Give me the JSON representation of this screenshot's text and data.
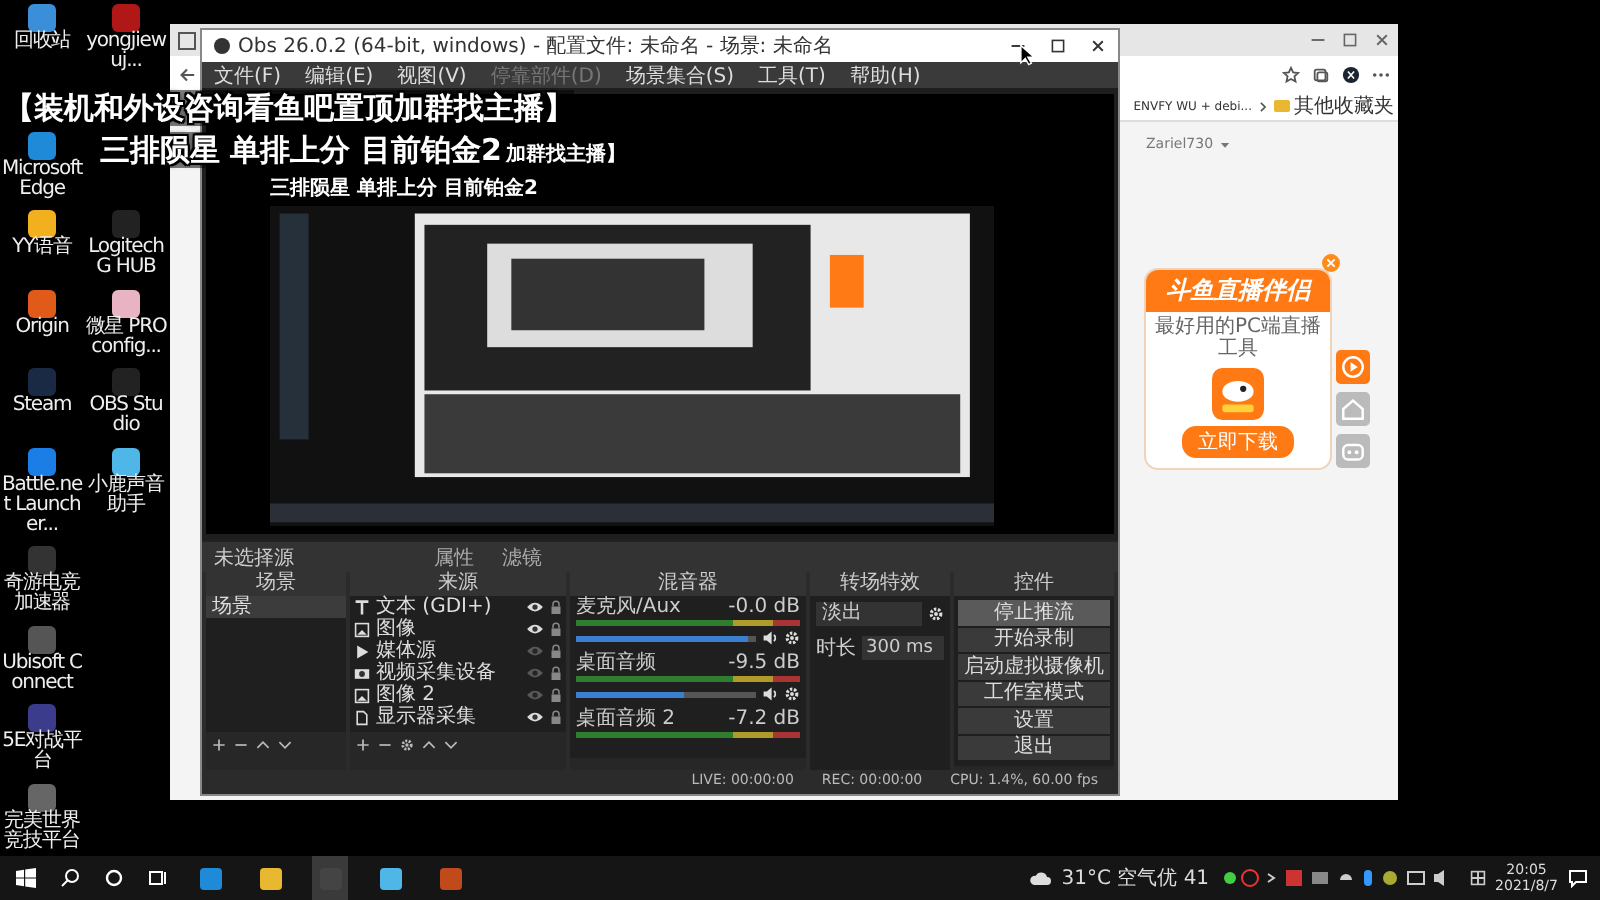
{
  "overlay": {
    "headline": "【装机和外设咨询看鱼吧置顶加群找主播】",
    "subline": "三排陨星 单排上分 目前铂金2",
    "subline_echo": "加群找主播】"
  },
  "desktop": {
    "icon_rows": [
      [
        {
          "label": "回收站"
        },
        {
          "label": "yongjiewuj..."
        }
      ],
      [
        {
          "label": "Microsoft Edge"
        }
      ],
      [
        {
          "label": "YY语音"
        },
        {
          "label": "Logitech G HUB"
        }
      ],
      [
        {
          "label": "Origin"
        },
        {
          "label": "微星 PROconfig..."
        }
      ],
      [
        {
          "label": "Steam"
        },
        {
          "label": "OBS Studio"
        }
      ],
      [
        {
          "label": "Battle.net Launcher..."
        },
        {
          "label": "小鹿声音助手"
        }
      ],
      [
        {
          "label": "奇游电竞加速器"
        }
      ],
      [
        {
          "label": "Ubisoft Connect"
        }
      ],
      [
        {
          "label": "5E对战平台"
        }
      ],
      [
        {
          "label": "完美世界竞技平台"
        }
      ]
    ]
  },
  "browser": {
    "bookmark": "ENVFY WU + debi...",
    "other_favorites": "其他收藏夹",
    "account": "Zariel730",
    "ad": {
      "title": "斗鱼直播伴侣",
      "tagline": "最好用的PC端直播工具",
      "download": "立即下载"
    }
  },
  "obs": {
    "title": "Obs 26.0.2 (64-bit, windows) - 配置文件: 未命名 - 场景: 未命名",
    "menu": [
      {
        "label": "文件(F)",
        "disabled": false
      },
      {
        "label": "编辑(E)",
        "disabled": false
      },
      {
        "label": "视图(V)",
        "disabled": false
      },
      {
        "label": "停靠部件(D)",
        "disabled": true
      },
      {
        "label": "场景集合(S)",
        "disabled": false
      },
      {
        "label": "工具(T)",
        "disabled": false
      },
      {
        "label": "帮助(H)",
        "disabled": false
      }
    ],
    "preview_caption": "三排陨星 单排上分 目前铂金2",
    "source_bar": {
      "label": "未选择源",
      "buttons": [
        "属性",
        "滤镜"
      ]
    },
    "scenes": {
      "title": "场景",
      "items": [
        {
          "label": "场景",
          "selected": true
        }
      ]
    },
    "sources": {
      "title": "来源",
      "items": [
        {
          "kind": "text",
          "label": "文本 (GDI+)",
          "visible": true
        },
        {
          "kind": "image",
          "label": "图像",
          "visible": true
        },
        {
          "kind": "media",
          "label": "媒体源",
          "visible": false
        },
        {
          "kind": "camera",
          "label": "视频采集设备",
          "visible": false
        },
        {
          "kind": "image",
          "label": "图像 2",
          "visible": false
        },
        {
          "kind": "monitor",
          "label": "显示器采集",
          "visible": true
        }
      ]
    },
    "mixer": {
      "title": "混音器",
      "channels": [
        {
          "name": "麦克风/Aux",
          "reading": "-0.0 dB",
          "level": 0.95
        },
        {
          "name": "桌面音频",
          "reading": "-9.5 dB",
          "level": 0.6
        },
        {
          "name": "桌面音频 2",
          "reading": "-7.2 dB"
        }
      ]
    },
    "transitions": {
      "title": "转场特效",
      "selected": "淡出",
      "duration_label": "时长",
      "duration": "300 ms"
    },
    "controls": {
      "title": "控件",
      "buttons": [
        {
          "label": "停止推流",
          "active": true
        },
        {
          "label": "开始录制",
          "active": false
        },
        {
          "label": "启动虚拟摄像机",
          "active": false
        },
        {
          "label": "工作室模式",
          "active": false
        },
        {
          "label": "设置",
          "active": false
        },
        {
          "label": "退出",
          "active": false
        }
      ]
    },
    "status": {
      "live": "LIVE: 00:00:00",
      "rec": "REC: 00:00:00",
      "cpu": "CPU: 1.4%, 60.00 fps"
    }
  },
  "taskbar": {
    "apps": [
      {
        "selected": false
      },
      {
        "selected": false
      },
      {
        "selected": true
      },
      {
        "selected": false
      },
      {
        "selected": false
      }
    ],
    "weather": "31°C 空气优 41",
    "time": "20:05",
    "date": "2021/8/7"
  }
}
